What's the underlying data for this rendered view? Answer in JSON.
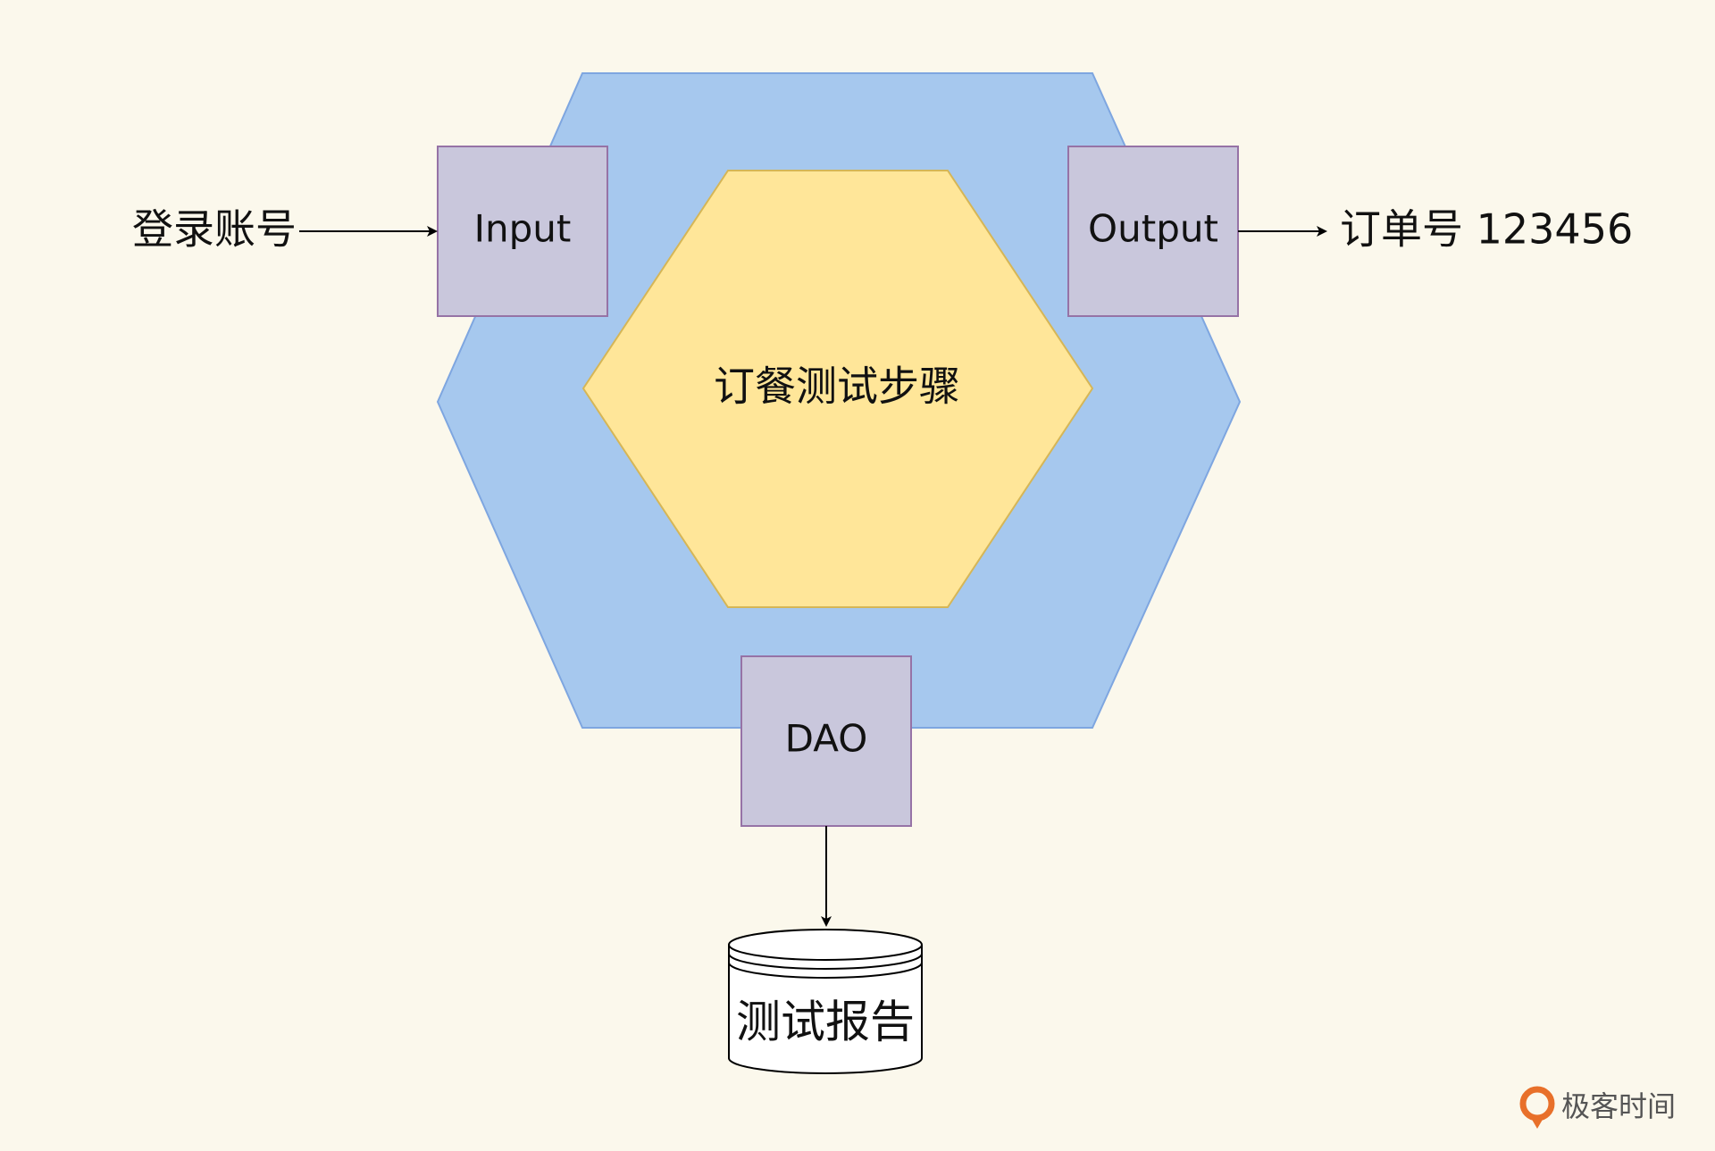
{
  "diagram": {
    "core_label": "订餐测试步骤",
    "input_label": "Input",
    "output_label": "Output",
    "dao_label": "DAO",
    "source_label": "登录账号",
    "result_label": "订单号 123456",
    "storage_label": "测试报告"
  },
  "brand": {
    "name": "极客时间"
  },
  "colors": {
    "background": "#FBF8EC",
    "outer_fill": "#A6C8EE",
    "outer_stroke": "#7EA6E0",
    "core_fill": "#FFE699",
    "core_stroke": "#D6B656",
    "port_fill": "#C9C7DC",
    "port_stroke": "#9673A6",
    "brand_accent": "#E8702A"
  }
}
